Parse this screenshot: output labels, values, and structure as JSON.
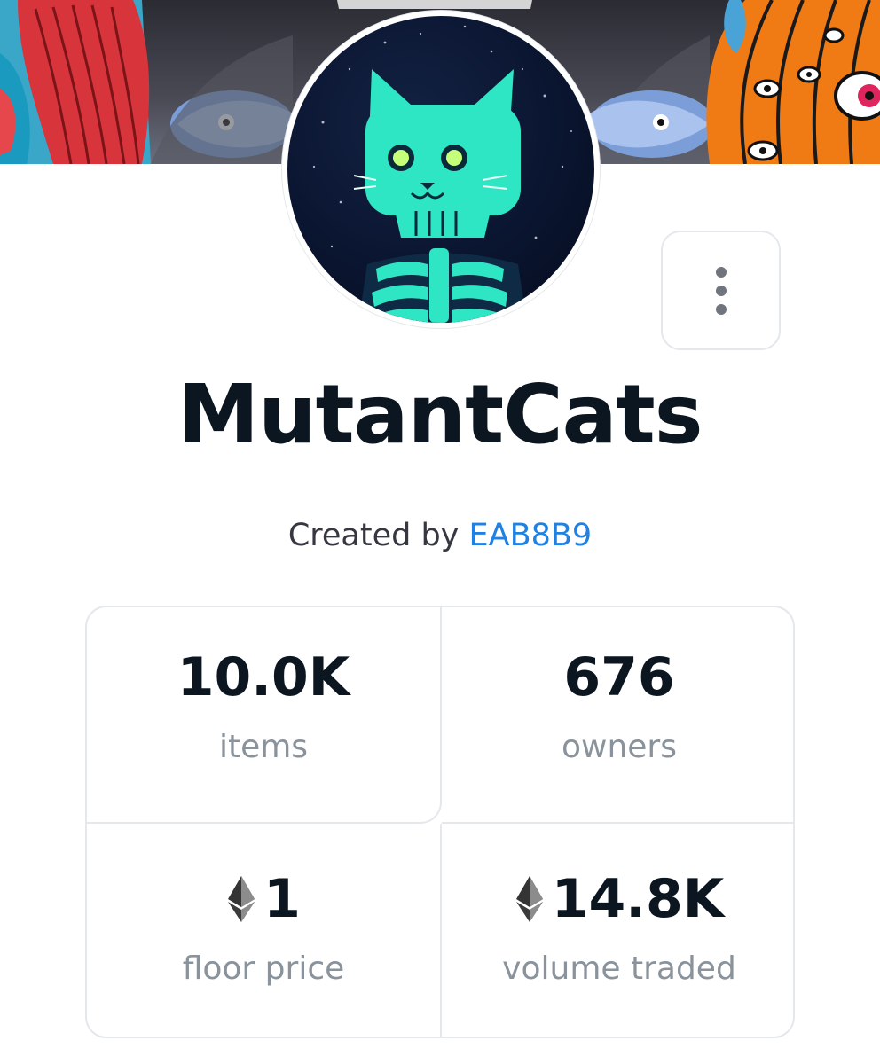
{
  "collection": {
    "name": "MutantCats",
    "created_by_prefix": "Created by",
    "creator": "EAB8B9"
  },
  "stats": [
    {
      "value": "10.0K",
      "label": "items",
      "currency_icon": ""
    },
    {
      "value": "676",
      "label": "owners",
      "currency_icon": ""
    },
    {
      "value": "1",
      "label": "floor price",
      "currency_icon": "ethereum-icon"
    },
    {
      "value": "14.8K",
      "label": "volume traded",
      "currency_icon": "ethereum-icon"
    }
  ],
  "colors": {
    "accent_link": "#2081e2",
    "title_text": "#0b1620",
    "label_text": "#8a939b",
    "border": "#e5e8eb",
    "avatar_cat": "#2ee6c4"
  }
}
